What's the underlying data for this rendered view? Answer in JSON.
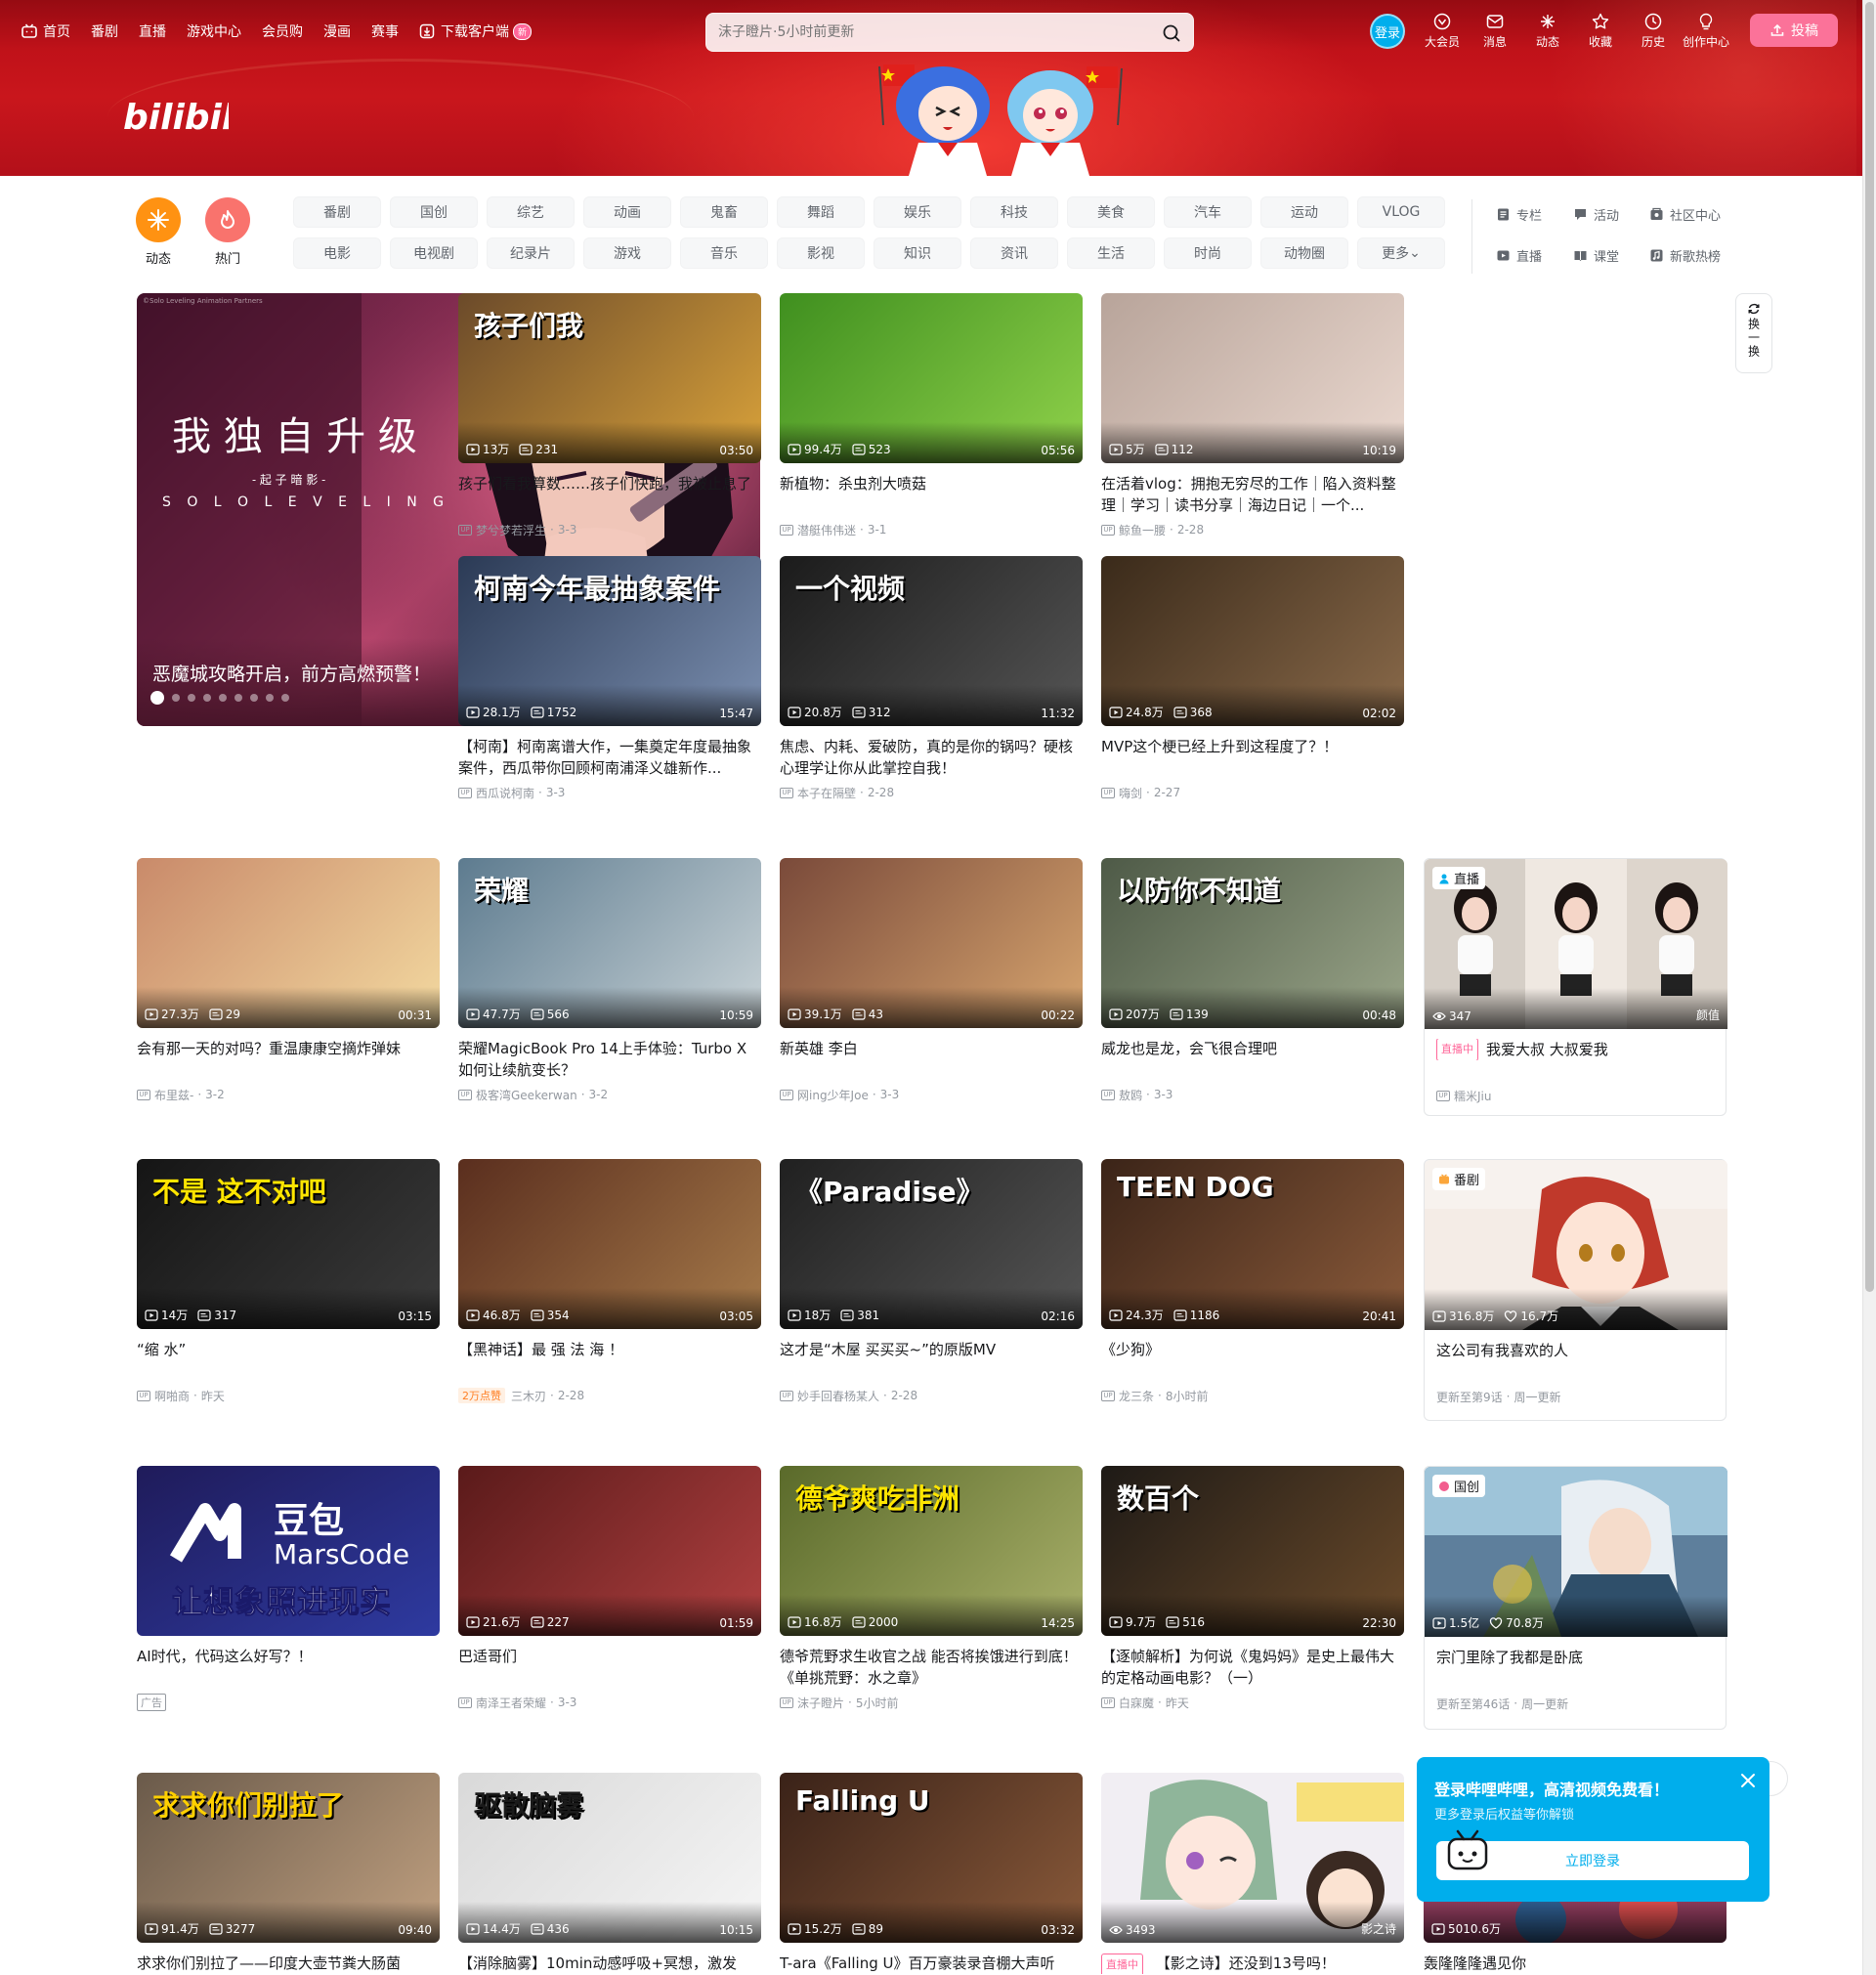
{
  "nav_left": [
    {
      "label": "首页",
      "icon": "tv-home-icon"
    },
    {
      "label": "番剧"
    },
    {
      "label": "直播"
    },
    {
      "label": "游戏中心"
    },
    {
      "label": "会员购"
    },
    {
      "label": "漫画"
    },
    {
      "label": "赛事"
    },
    {
      "label": "下载客户端",
      "icon": "download-icon",
      "badge": "新"
    }
  ],
  "search": {
    "placeholder": "沫子瞪片·5小时前更新"
  },
  "login_avatar": "登录",
  "nav_right": [
    {
      "label": "大会员",
      "icon": "vip-icon"
    },
    {
      "label": "消息",
      "icon": "message-icon"
    },
    {
      "label": "动态",
      "icon": "dynamic-icon"
    },
    {
      "label": "收藏",
      "icon": "star-icon"
    },
    {
      "label": "历史",
      "icon": "clock-icon"
    },
    {
      "label": "创作中心",
      "icon": "bulb-icon"
    }
  ],
  "upload": "投稿",
  "logo_text": "bilibili",
  "big_buttons": [
    {
      "label": "动态",
      "color": "#ff9212"
    },
    {
      "label": "热门",
      "color": "#f9736d"
    }
  ],
  "channels_row1": [
    "番剧",
    "国创",
    "综艺",
    "动画",
    "鬼畜",
    "舞蹈",
    "娱乐",
    "科技",
    "美食",
    "汽车",
    "运动",
    "VLOG"
  ],
  "channels_row2": [
    "电影",
    "电视剧",
    "纪录片",
    "游戏",
    "音乐",
    "影视",
    "知识",
    "资讯",
    "生活",
    "时尚",
    "动物圈",
    "更多"
  ],
  "right_links": [
    {
      "label": "专栏",
      "icon": "column-icon"
    },
    {
      "label": "活动",
      "icon": "activity-icon"
    },
    {
      "label": "社区中心",
      "icon": "community-icon"
    },
    {
      "label": "直播",
      "icon": "live-icon"
    },
    {
      "label": "课堂",
      "icon": "classroom-icon"
    },
    {
      "label": "新歌热榜",
      "icon": "music-chart-icon"
    }
  ],
  "carousel": {
    "caption": "恶魔城攻略开启，前方高燃预警！",
    "art_title": "我 独 自 升 级",
    "art_sub": "- 起 子 暗 影 -",
    "art_en": "S O L O   L E V E L I N G",
    "watermark": "©Solo Leveling Animation Partners",
    "slides": 9
  },
  "refresh": "换一换",
  "cards": [
    {
      "views": "13万",
      "danmaku": "231",
      "duration": "03:50",
      "title": "孩子们看我算数……孩子们快跑，我被止息了",
      "up": "梦兮梦若浮生",
      "date": "3-3",
      "overlay": "孩子们我",
      "bg": "#6b4a2a",
      "bg2": "#d9a23a"
    },
    {
      "views": "99.4万",
      "danmaku": "523",
      "duration": "05:56",
      "title": "新植物：杀虫剂大喷菇",
      "up": "潜艇伟伟迷",
      "date": "3-1",
      "overlay": "",
      "bg": "#3f8f1f",
      "bg2": "#8fd14a"
    },
    {
      "views": "5万",
      "danmaku": "112",
      "duration": "10:19",
      "title": "在活着vlog：拥抱无穷尽的工作｜陷入资料整理｜学习｜读书分享｜海边日记｜一个...",
      "up": "鲸鱼一腰",
      "date": "2-28",
      "overlay": "",
      "bg": "#b8a49a",
      "bg2": "#ead8cf"
    },
    {
      "views": "28.1万",
      "danmaku": "1752",
      "duration": "15:47",
      "title": "【柯南】柯南离谱大作，一集奠定年度最抽象案件，西瓜带你回顾柯南浦泽义雄新作...",
      "up": "西瓜说柯南",
      "date": "3-3",
      "overlay": "柯南今年最抽象案件",
      "bg": "#2b3a55",
      "bg2": "#7b8fb0"
    },
    {
      "views": "20.8万",
      "danmaku": "312",
      "duration": "11:32",
      "title": "焦虑、内耗、爱破防，真的是你的锅吗？硬核心理学让你从此掌控自我！",
      "up": "本子在隔壁",
      "date": "2-28",
      "overlay": "一个视频",
      "bg": "#1b1b1b",
      "bg2": "#555555"
    },
    {
      "views": "24.8万",
      "danmaku": "368",
      "duration": "02:02",
      "title": "MVP这个梗已经上升到这程度了？！",
      "up": "嗨剑",
      "date": "2-27",
      "overlay": "",
      "bg": "#3a2a1a",
      "bg2": "#8a6a4a"
    },
    {
      "views": "27.3万",
      "danmaku": "29",
      "duration": "00:31",
      "title": "会有那一天的对吗？重温康康空摘炸弹妹",
      "up": "布里兹-",
      "date": "3-2",
      "overlay": "",
      "bg": "#c98a6a",
      "bg2": "#f3d9a0"
    },
    {
      "views": "47.7万",
      "danmaku": "566",
      "duration": "10:59",
      "title": "荣耀MagicBook Pro 14上手体验：Turbo X如何让续航变长？",
      "up": "极客湾Geekerwan",
      "date": "3-2",
      "overlay": "荣耀",
      "bg": "#5d7b8f",
      "bg2": "#c9d3d7"
    },
    {
      "views": "39.1万",
      "danmaku": "43",
      "duration": "00:22",
      "title": "新英雄 李白",
      "up": "网ing少年Joe",
      "date": "3-3",
      "overlay": "",
      "bg": "#7a4a3a",
      "bg2": "#d7a56f"
    },
    {
      "views": "207万",
      "danmaku": "139",
      "duration": "00:48",
      "title": "威龙也是龙，会飞很合理吧",
      "up": "敖鸥",
      "date": "3-3",
      "overlay": "以防你不知道",
      "bg": "#4e5a47",
      "bg2": "#9aa589"
    },
    {
      "views": "14万",
      "danmaku": "317",
      "duration": "03:15",
      "title": "“缩 水”",
      "up": "啊啪商",
      "date": "昨天",
      "overlay": "不是 这不对吧",
      "bg": "#151515",
      "bg2": "#3b3b3b"
    },
    {
      "views": "46.8万",
      "danmaku": "354",
      "duration": "03:05",
      "title": "【黑神话】最 强 法 海 ！",
      "up": "三木刃",
      "date": "2-28",
      "overlay": "",
      "bg": "#5a2e1e",
      "bg2": "#a67a4a",
      "hot": "2万点赞"
    },
    {
      "views": "18万",
      "danmaku": "381",
      "duration": "02:16",
      "title": "这才是“木屋 买买买~”的原版MV",
      "up": "妙手回春杨某人",
      "date": "2-28",
      "overlay": "《Paradise》",
      "bg": "#202020",
      "bg2": "#555555"
    },
    {
      "views": "24.3万",
      "danmaku": "1186",
      "duration": "20:41",
      "title": "《少狗》",
      "up": "龙三条",
      "date": "8小时前",
      "overlay": "TEEN DOG",
      "bg": "#3b2418",
      "bg2": "#8a5a3a"
    },
    {
      "views": "21.6万",
      "danmaku": "227",
      "duration": "01:59",
      "title": "巴适哥们",
      "up": "南泽王者荣耀",
      "date": "3-3",
      "overlay": "",
      "bg": "#5a1a1a",
      "bg2": "#b04040"
    },
    {
      "views": "16.8万",
      "danmaku": "2000",
      "duration": "14:25",
      "title": "德爷荒野求生收官之战 能否将挨饿进行到底！《单挑荒野：水之章》",
      "up": "沫子瞪片",
      "date": "5小时前",
      "overlay": "德爷爽吃非洲",
      "bg": "#5a6a2a",
      "bg2": "#a9b06a"
    },
    {
      "views": "9.7万",
      "danmaku": "516",
      "duration": "22:30",
      "title": "【逐帧解析】为何说《鬼妈妈》是史上最伟大的定格动画电影？（一）",
      "up": "白寐魔",
      "date": "昨天",
      "overlay": "数百个",
      "bg": "#1e1a16",
      "bg2": "#6a4a2a"
    },
    {
      "views": "91.4万",
      "danmaku": "3277",
      "duration": "09:40",
      "title": "求求你们别拉了——印度大壶节粪大肠菌",
      "up": "",
      "date": "",
      "overlay": "求求你们别拉了",
      "bg": "#6a5a4a",
      "bg2": "#c0a080"
    },
    {
      "views": "14.4万",
      "danmaku": "436",
      "duration": "10:15",
      "title": "【消除脑雾】10min动感呼吸+冥想，激发",
      "up": "",
      "date": "",
      "overlay": "驱散脑雾",
      "bg": "#d9d9d9",
      "bg2": "#f5f5f5"
    },
    {
      "views": "15.2万",
      "danmaku": "89",
      "duration": "03:32",
      "title": "T-ara《Falling U》百万豪装录音棚大声听",
      "up": "",
      "date": "",
      "overlay": "Falling U",
      "bg": "#3a2218",
      "bg2": "#8a5a3a"
    }
  ],
  "live_card": {
    "tag": "直播",
    "viewers": "347",
    "category": "颜值",
    "badge": "直播中",
    "title": "我爱大叔 大叔爱我",
    "up": "糯米Jiu"
  },
  "bangumi_card": {
    "tag": "番剧",
    "views": "316.8万",
    "likes": "16.7万",
    "title": "这公司有我喜欢的人",
    "meta": "更新至第9话",
    "schedule": "周一更新"
  },
  "ad_card": {
    "title": "AI时代，代码这么好写？！",
    "ad": "广告",
    "brand": "豆包",
    "brand2": "MarsCode",
    "slogan": "让想象照进现实"
  },
  "guochuang_card": {
    "tag": "国创",
    "views": "1.5亿",
    "likes": "70.8万",
    "title": "宗门里除了我都是卧底",
    "meta": "更新至第46话",
    "schedule": "周一更新"
  },
  "live_card2": {
    "viewers": "3493",
    "badge": "直播中",
    "title": "【影之诗】还没到13号吗！",
    "watermark": "影之诗"
  },
  "extra_card": {
    "views": "5010.6万",
    "title": "轰隆隆隆遇见你"
  },
  "popup": {
    "title": "登录哔哩哔哩，高清视频免费看！",
    "sub": "更多登录后权益等你解锁",
    "button": "立即登录"
  }
}
